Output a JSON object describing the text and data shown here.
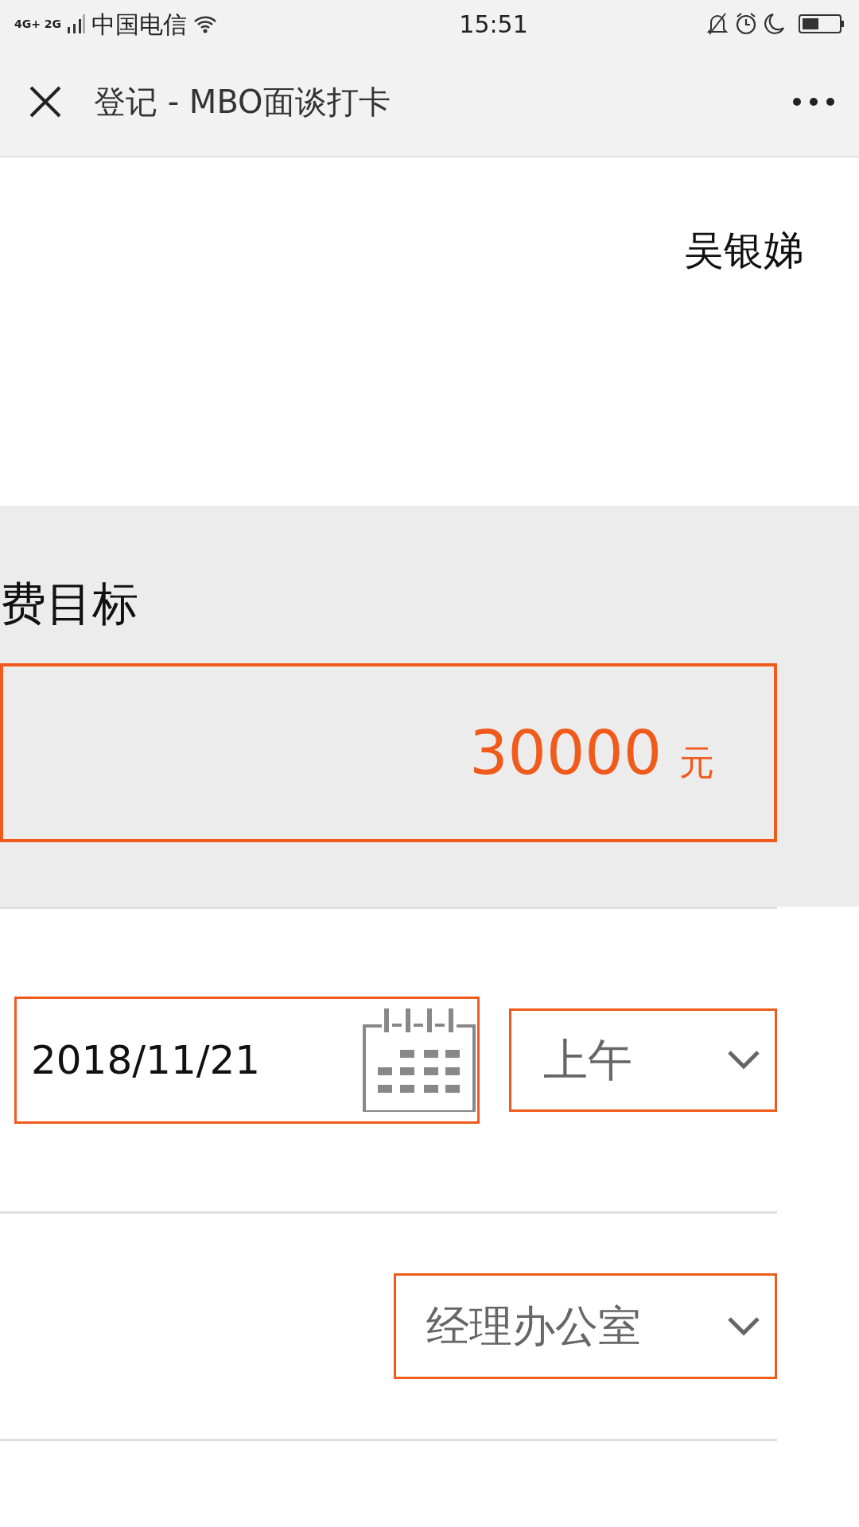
{
  "status_bar": {
    "carrier": "中国电信",
    "time": "15:51",
    "network": "4G+ 2G"
  },
  "header": {
    "title": "登记 - MBO面谈打卡"
  },
  "user_name": "吴银娣",
  "target": {
    "label": "费目标",
    "value": "30000",
    "unit": "元"
  },
  "date_field": {
    "value": "2018/11/21"
  },
  "period_select": {
    "value": "上午"
  },
  "location_select": {
    "value": "经理办公室"
  }
}
